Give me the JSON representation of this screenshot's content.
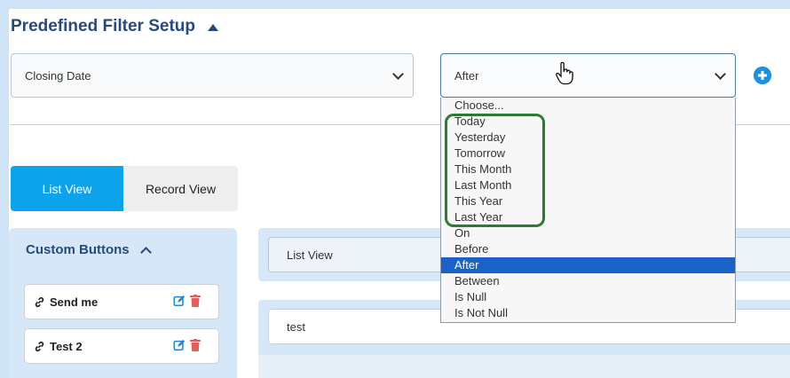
{
  "header": {
    "title": "Predefined Filter Setup"
  },
  "filter": {
    "field_value": "Closing Date",
    "operator_value": "After",
    "operator_options": [
      "Choose...",
      "Today",
      "Yesterday",
      "Tomorrow",
      "This Month",
      "Last Month",
      "This Year",
      "Last Year",
      "On",
      "Before",
      "After",
      "Between",
      "Is Null",
      "Is Not Null"
    ],
    "selected_option": "After"
  },
  "tabs": [
    {
      "label": "List View",
      "active": true
    },
    {
      "label": "Record View",
      "active": false
    }
  ],
  "sidebar": {
    "title": "Custom Buttons",
    "buttons": [
      {
        "label": "Send me"
      },
      {
        "label": "Test 2"
      }
    ]
  },
  "main": {
    "view_select_value": "List View",
    "text_value": "test"
  },
  "colors": {
    "accent": "#0da3ea",
    "title": "#274a7d",
    "selected_option": "#1a62c8",
    "highlight_box": "#2c7a35",
    "delete_icon": "#e0605a",
    "edit_icon": "#1e88c8"
  },
  "icons": [
    "chevron-up-icon",
    "chevron-down-icon",
    "plus-circle-icon",
    "link-icon",
    "edit-icon",
    "trash-icon",
    "hand-cursor-icon"
  ]
}
